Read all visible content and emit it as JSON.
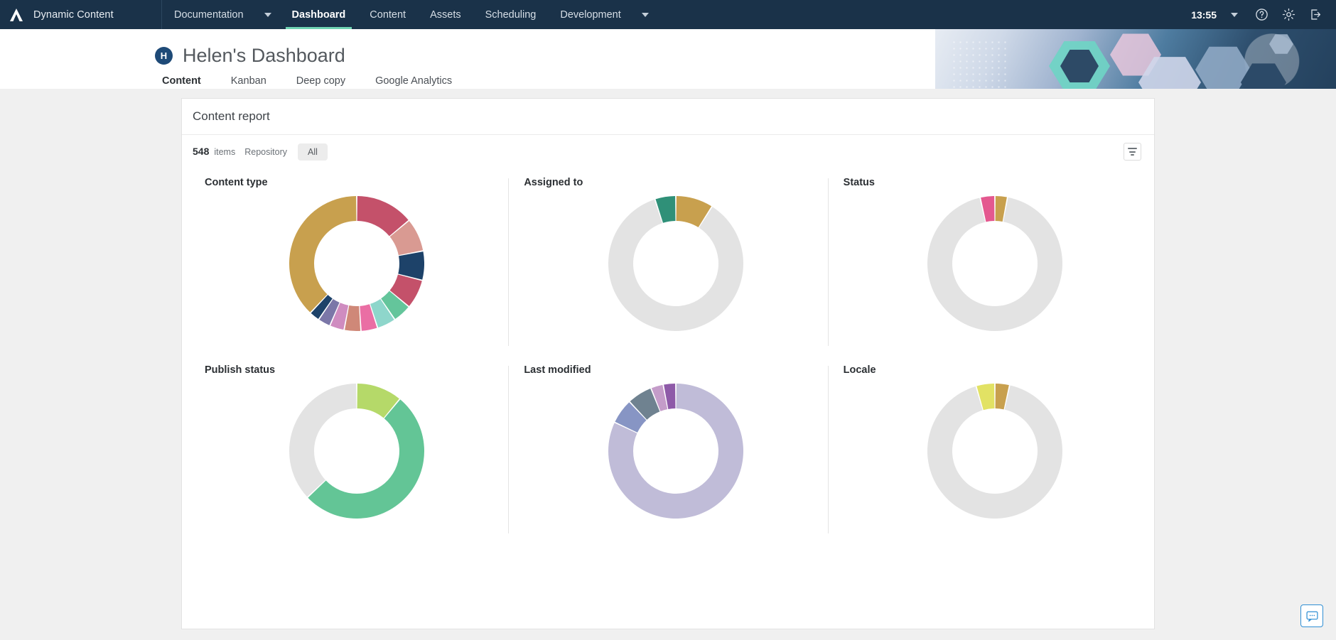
{
  "topbar": {
    "brand": "Dynamic Content",
    "logo_icon": "amplience-triangle-logo",
    "nav": [
      {
        "label": "Documentation",
        "active": false,
        "caret": true
      },
      {
        "label": "Dashboard",
        "active": true,
        "caret": false
      },
      {
        "label": "Content",
        "active": false,
        "caret": false
      },
      {
        "label": "Assets",
        "active": false,
        "caret": false
      },
      {
        "label": "Scheduling",
        "active": false,
        "caret": false
      },
      {
        "label": "Development",
        "active": false,
        "caret": true
      }
    ],
    "clock": "13:55",
    "clock_caret_icon": "chevron-down-icon",
    "help_icon": "help-circle-icon",
    "settings_icon": "gear-icon",
    "logout_icon": "logout-icon",
    "accent_active": "#6fd4b3",
    "background": "#1a3249"
  },
  "pagehead": {
    "avatar_initial": "H",
    "title": "Helen's Dashboard",
    "tabs": [
      {
        "label": "Content",
        "active": true
      },
      {
        "label": "Kanban",
        "active": false
      },
      {
        "label": "Deep copy",
        "active": false
      },
      {
        "label": "Google Analytics",
        "active": false
      }
    ],
    "tab_accent": "#2f8fd4"
  },
  "report": {
    "title": "Content report",
    "count": "548",
    "count_unit": "items",
    "filter_label": "Repository",
    "filter_value": "All",
    "filter_button_icon": "filter-icon"
  },
  "chart_data": [
    {
      "type": "pie",
      "title": "Content type",
      "legend": "none",
      "total": 548,
      "segments": [
        {
          "label": "Segment 1",
          "value": 14.0,
          "color": "#c4516a"
        },
        {
          "label": "Segment 2",
          "value": 8.0,
          "color": "#d99a92"
        },
        {
          "label": "Segment 3",
          "value": 7.0,
          "color": "#1d4269"
        },
        {
          "label": "Segment 4",
          "value": 7.0,
          "color": "#c4516a"
        },
        {
          "label": "Segment 5",
          "value": 4.5,
          "color": "#64c59b"
        },
        {
          "label": "Segment 6",
          "value": 4.5,
          "color": "#8ed6cb"
        },
        {
          "label": "Segment 7",
          "value": 4.0,
          "color": "#ea6ea4"
        },
        {
          "label": "Segment 8",
          "value": 4.0,
          "color": "#cf8878"
        },
        {
          "label": "Segment 9",
          "value": 3.5,
          "color": "#cf8cc0"
        },
        {
          "label": "Segment 10",
          "value": 3.0,
          "color": "#7b77a8"
        },
        {
          "label": "Segment 11",
          "value": 2.5,
          "color": "#1d4269"
        },
        {
          "label": "Segment 12",
          "value": 38.0,
          "color": "#c8a04e"
        }
      ]
    },
    {
      "type": "pie",
      "title": "Assigned to",
      "legend": "none",
      "total": 548,
      "segments": [
        {
          "label": "Segment 1",
          "value": 9.0,
          "color": "#c8a04e"
        },
        {
          "label": "Segment 2",
          "value": 86.0,
          "color": "#e3e3e3"
        },
        {
          "label": "Segment 3",
          "value": 5.0,
          "color": "#2f9078"
        }
      ]
    },
    {
      "type": "pie",
      "title": "Status",
      "legend": "none",
      "total": 548,
      "segments": [
        {
          "label": "Segment 1",
          "value": 3.0,
          "color": "#c8a04e"
        },
        {
          "label": "Segment 2",
          "value": 93.5,
          "color": "#e3e3e3"
        },
        {
          "label": "Segment 3",
          "value": 3.5,
          "color": "#e4588f"
        }
      ]
    },
    {
      "type": "pie",
      "title": "Publish status",
      "legend": "none",
      "total": 548,
      "segments": [
        {
          "label": "Segment 1",
          "value": 11.0,
          "color": "#b5d969"
        },
        {
          "label": "Segment 2",
          "value": 52.0,
          "color": "#63c596"
        },
        {
          "label": "Segment 3",
          "value": 37.0,
          "color": "#e3e3e3"
        }
      ]
    },
    {
      "type": "pie",
      "title": "Last modified",
      "legend": "none",
      "total": 548,
      "segments": [
        {
          "label": "Segment 1",
          "value": 82.0,
          "color": "#c0bcd8"
        },
        {
          "label": "Segment 2",
          "value": 6.0,
          "color": "#8795c4"
        },
        {
          "label": "Segment 3",
          "value": 6.0,
          "color": "#6f8290"
        },
        {
          "label": "Segment 4",
          "value": 3.0,
          "color": "#c49cc9"
        },
        {
          "label": "Segment 5",
          "value": 3.0,
          "color": "#8e5aa8"
        }
      ]
    },
    {
      "type": "pie",
      "title": "Locale",
      "legend": "none",
      "total": 548,
      "segments": [
        {
          "label": "Segment 1",
          "value": 3.5,
          "color": "#c8a04e"
        },
        {
          "label": "Segment 2",
          "value": 92.0,
          "color": "#e3e3e3"
        },
        {
          "label": "Segment 3",
          "value": 4.5,
          "color": "#e2e264"
        }
      ]
    }
  ],
  "support": {
    "icon": "chat-support-icon",
    "color": "#2f8fd4"
  }
}
